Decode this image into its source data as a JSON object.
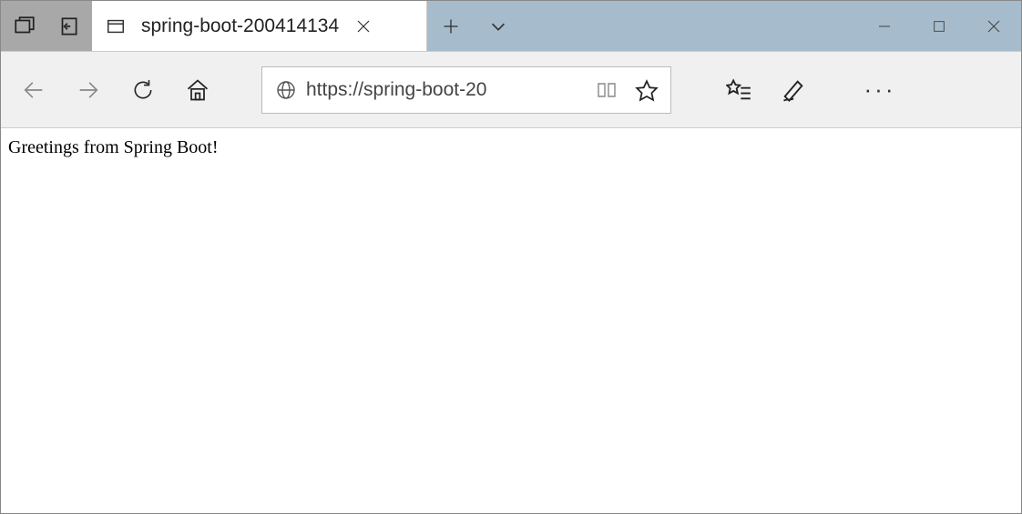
{
  "titlebar": {
    "tab_title": "spring-boot-200414134"
  },
  "toolbar": {
    "url_display": "https://spring-boot-20"
  },
  "page": {
    "body_text": "Greetings from Spring Boot!"
  }
}
